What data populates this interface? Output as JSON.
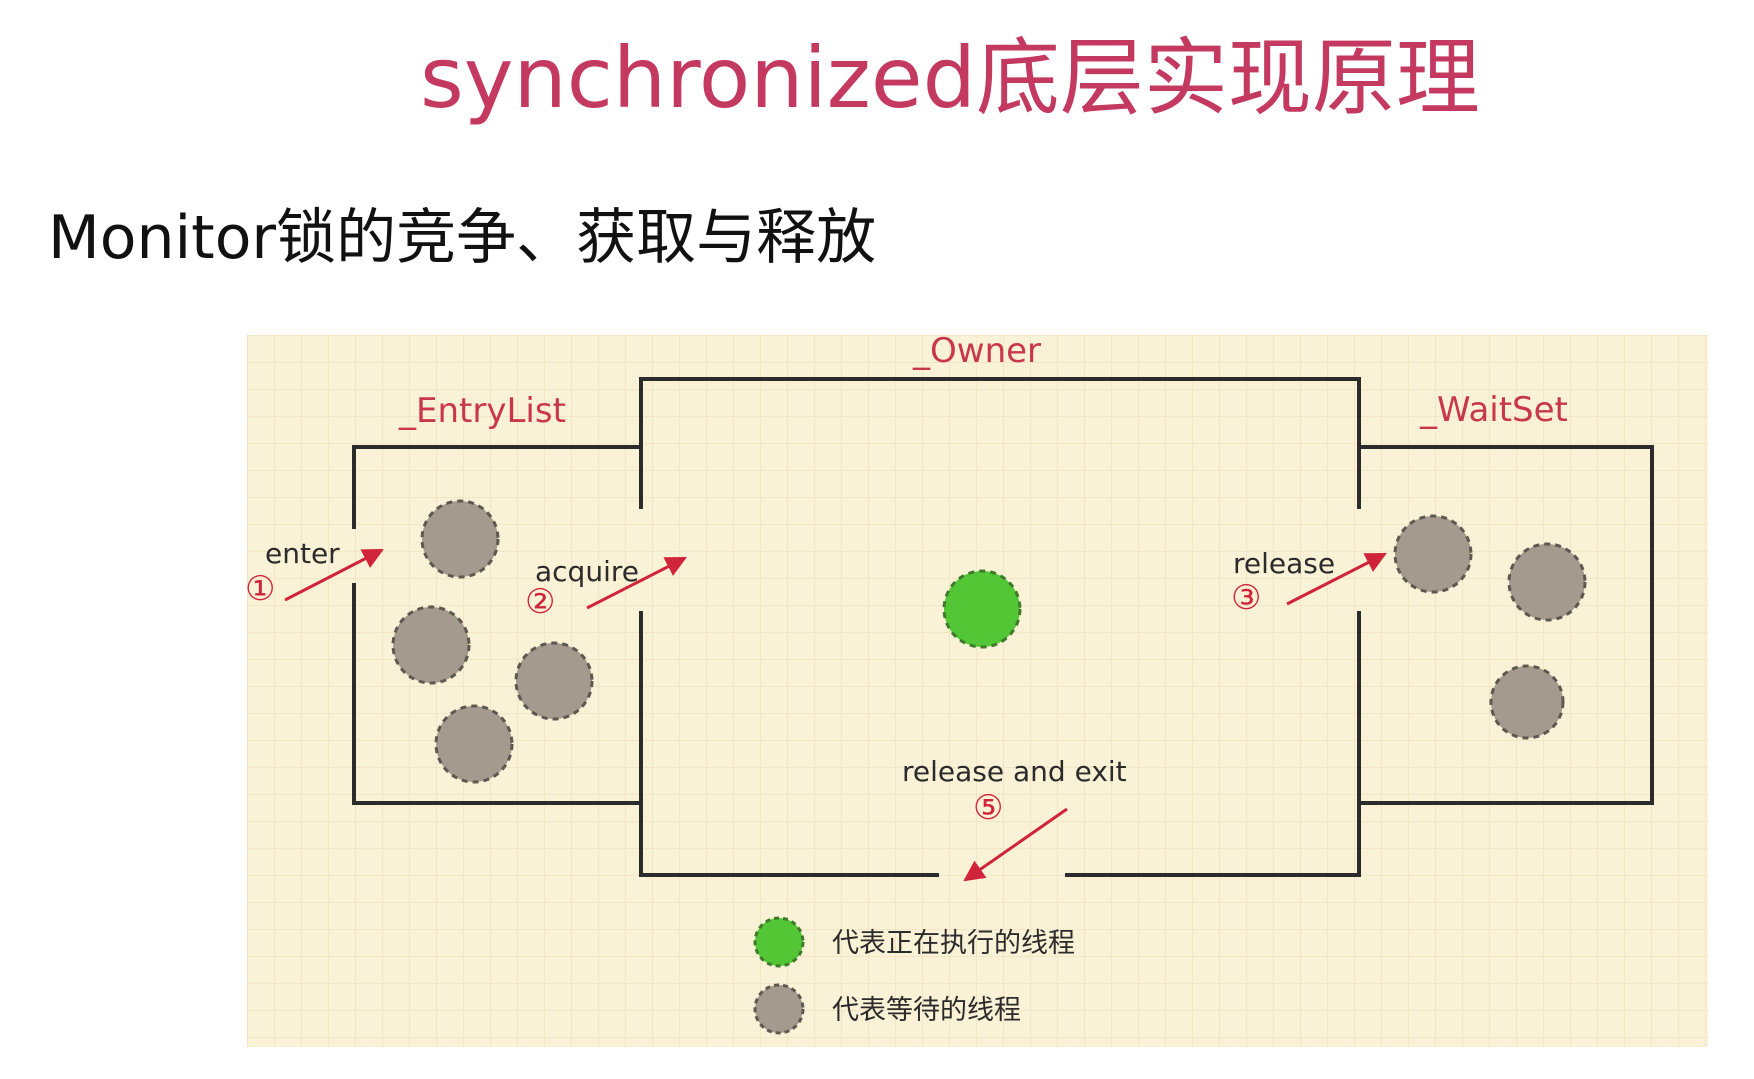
{
  "title": "synchronized底层实现原理",
  "subtitle": "Monitor锁的竞争、获取与释放",
  "diagram": {
    "regions": {
      "entry_list": "_EntryList",
      "owner": "_Owner",
      "wait_set": "_WaitSet"
    },
    "steps": [
      {
        "number": "①",
        "label": "enter"
      },
      {
        "number": "②",
        "label": "acquire"
      },
      {
        "number": "③",
        "label": "release"
      },
      {
        "number": "⑤",
        "label": "release and exit"
      }
    ],
    "legend": [
      {
        "label": "代表正在执行的线程",
        "kind": "running"
      },
      {
        "label": "代表等待的线程",
        "kind": "waiting"
      }
    ],
    "colors": {
      "background": "#faf2d6",
      "grid": "#ead9b8",
      "wall": "#2b2b2b",
      "region_label": "#c8384a",
      "arrow": "#d0243b",
      "running_thread": "#52c634",
      "waiting_thread": "#a49a8d"
    }
  }
}
